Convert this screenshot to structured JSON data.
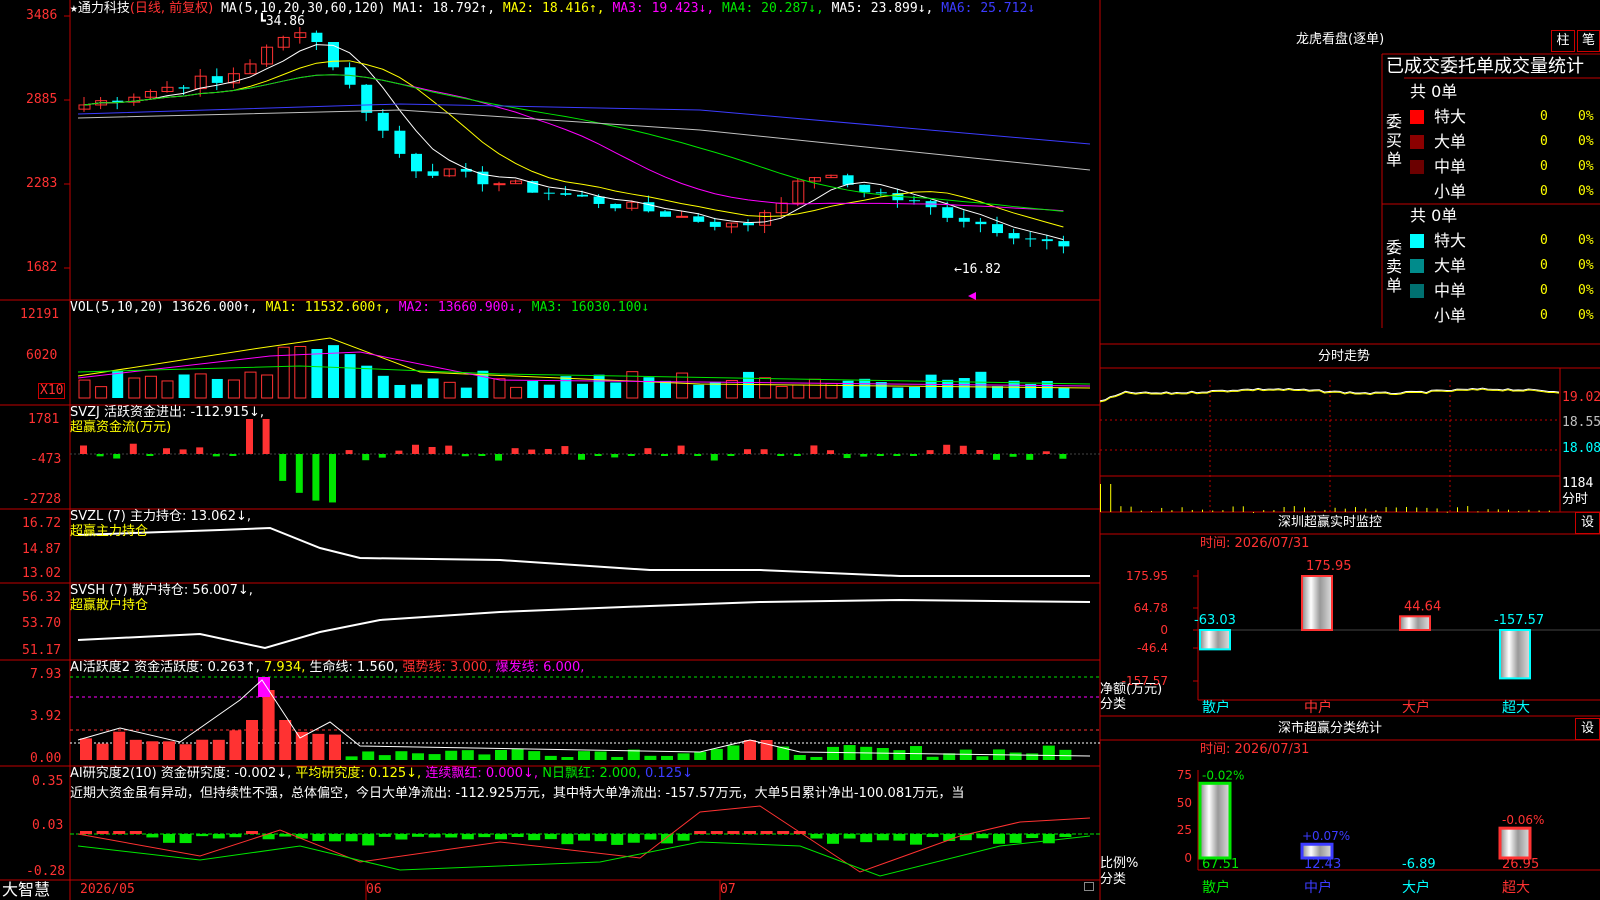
{
  "main": {
    "title_star": "★",
    "stock_name": "通力科技",
    "mode": "(日线, 前复权)",
    "ma_params": "MA(5,10,20,30,60,120)",
    "ma1": "MA1: 18.792↑,",
    "ma2": "MA2: 18.416↑,",
    "ma3": "MA3: 19.423↓,",
    "ma4": "MA4: 20.287↓,",
    "ma5": "MA5: 23.899↓,",
    "ma6": "MA6: 25.712↓",
    "high_mark": "34.86",
    "low_mark": "←16.82",
    "y_ticks": [
      "3486",
      "2885",
      "2283",
      "1682"
    ]
  },
  "vol": {
    "label": "VOL(5,10,20)",
    "value": "13626.000↑,",
    "ma1": "MA1: 11532.600↑,",
    "ma2": "MA2: 13660.900↓,",
    "ma3": "MA3: 16030.100↓",
    "y_ticks": [
      "12191",
      "6020"
    ],
    "unit": "X10"
  },
  "svzj": {
    "label": "SVZJ  活跃资金进出: -112.915↓,",
    "sub": "超赢资金流(万元)",
    "y_ticks": [
      "1781",
      "-473",
      "-2728"
    ]
  },
  "svzl": {
    "label": "SVZL (7) 主力持仓: 13.062↓,",
    "sub": "超赢主力持仓",
    "y_ticks": [
      "16.72",
      "14.87",
      "13.02"
    ]
  },
  "svsh": {
    "label": "SVSH (7) 散户持仓: 56.007↓,",
    "sub": "超赢散户持仓",
    "y_ticks": [
      "56.32",
      "53.70",
      "51.17"
    ]
  },
  "ai1": {
    "label": "AI活跃度2 资金活跃度: 0.263↑,",
    "v2": "7.934,",
    "life": "生命线: 1.560,",
    "strong": "强势线: 3.000,",
    "burst": "爆发线: 6.000,",
    "y_ticks": [
      "7.93",
      "3.92",
      "0.00"
    ]
  },
  "ai2": {
    "label": "AI研究度2(10) 资金研究度: -0.002↓,",
    "avg": "平均研究度: 0.125↓,",
    "cont": "连续飘红: 0.000↓,",
    "nday": "N日飘红: 2.000,",
    "val": "0.125↓",
    "comment": "近期大资金虽有异动，但持续性不强，总体偏空，今日大单净流出: -112.925万元，其中特大单净流出: -157.57万元，大单5日累计净出-100.081万元，当",
    "y_ticks": [
      "0.35",
      "0.03",
      "-0.28"
    ]
  },
  "bottom": {
    "brand": "大智慧",
    "date1": "2026/05",
    "date2": "06",
    "date3": "07"
  },
  "lhb": {
    "title": "龙虎看盘(逐单)",
    "btn1": "柱",
    "btn2": "笔",
    "header": "已成交委托单成交量统计",
    "buy_total": "共 0单",
    "sell_total": "共 0单",
    "buy_side": "委买单",
    "sell_side": "委卖单",
    "buy_rows": [
      {
        "name": "特大",
        "count": "0",
        "pct": "0%",
        "color": "#ff0000"
      },
      {
        "name": "大单",
        "count": "0",
        "pct": "0%",
        "color": "#8b0000"
      },
      {
        "name": "中单",
        "count": "0",
        "pct": "0%",
        "color": "#6b0000"
      },
      {
        "name": "小单",
        "count": "0",
        "pct": "0%",
        "color": ""
      }
    ],
    "sell_rows": [
      {
        "name": "特大",
        "count": "0",
        "pct": "0%",
        "color": "#00ffff"
      },
      {
        "name": "大单",
        "count": "0",
        "pct": "0%",
        "color": "#008b8b"
      },
      {
        "name": "中单",
        "count": "0",
        "pct": "0%",
        "color": "#007070"
      },
      {
        "name": "小单",
        "count": "0",
        "pct": "0%",
        "color": ""
      }
    ]
  },
  "fenshi": {
    "title": "分时走势",
    "y_ticks": [
      "19.02",
      "18.55",
      "18.08",
      "1184"
    ],
    "unit": "分时"
  },
  "monitor": {
    "title": "深圳超赢实时监控",
    "btn": "设",
    "time": "时间: 2026/07/31",
    "y_ticks": [
      "175.95",
      "64.78",
      "0",
      "-46.4",
      "-157.57"
    ],
    "ylabel": "净额(万元)",
    "xlabel": "分类",
    "bars": [
      {
        "name": "散户",
        "value": -63.03,
        "label": "-63.03",
        "color": "#00ffff"
      },
      {
        "name": "中户",
        "value": 175.95,
        "label": "175.95",
        "color": "#ff3232"
      },
      {
        "name": "大户",
        "value": 44.64,
        "label": "44.64",
        "color": "#ff3232"
      },
      {
        "name": "超大",
        "value": -157.57,
        "label": "-157.57",
        "color": "#00ffff"
      }
    ]
  },
  "stat": {
    "title": "深市超赢分类统计",
    "btn": "设",
    "time": "时间: 2026/07/31",
    "y_ticks": [
      "75",
      "50",
      "25",
      "0"
    ],
    "ylabel": "比例%",
    "xlabel": "分类",
    "bars": [
      {
        "name": "散户",
        "value": 67.51,
        "label": "67.51",
        "delta": "-0.02%",
        "color": "#00e600"
      },
      {
        "name": "中户",
        "value": 12.43,
        "label": "12.43",
        "delta": "+0.07%",
        "color": "#3c3cff"
      },
      {
        "name": "大户",
        "value": -6.89,
        "label": "-6.89",
        "delta": "",
        "color": "#00ffff"
      },
      {
        "name": "超大",
        "value": 26.95,
        "label": "26.95",
        "delta": "-0.06%",
        "color": "#ff3232"
      }
    ]
  }
}
